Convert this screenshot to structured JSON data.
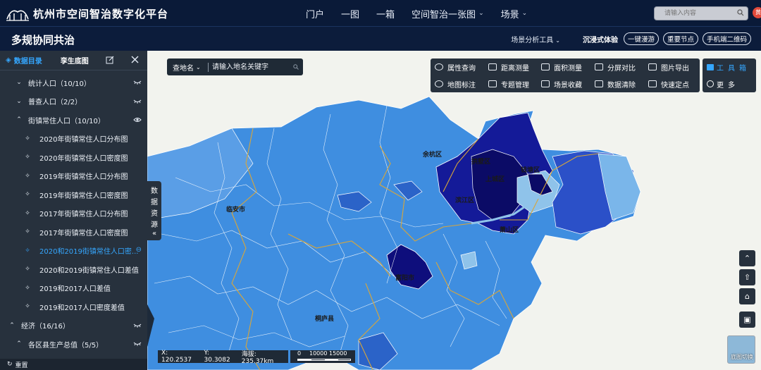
{
  "header": {
    "title": "杭州市空间智治数字化平台",
    "nav": [
      {
        "label": "门户",
        "has_menu": false
      },
      {
        "label": "一图",
        "has_menu": false
      },
      {
        "label": "一箱",
        "has_menu": false
      },
      {
        "label": "空间智治一张图",
        "has_menu": true
      },
      {
        "label": "场景",
        "has_menu": true
      }
    ],
    "search_placeholder": "请输入内容",
    "user_badge": "黄"
  },
  "subheader": {
    "title": "多规协同共治",
    "scene_tools_label": "场景分析工具",
    "immersive_label": "沉浸式体验",
    "buttons": [
      "一键漫游",
      "重要节点",
      "手机端二维码"
    ]
  },
  "left_panel": {
    "tabs": [
      {
        "label": "数据目录",
        "active": true
      },
      {
        "label": "孪生底图",
        "active": false
      }
    ],
    "tree": [
      {
        "label": "统计人口（10/10）",
        "level": 1,
        "expanded": false,
        "eye": "closed"
      },
      {
        "label": "普查人口（2/2）",
        "level": 1,
        "expanded": false,
        "eye": "closed"
      },
      {
        "label": "街镇常住人口（10/10）",
        "level": 1,
        "expanded": true,
        "eye": "open"
      },
      {
        "label": "2020年街镇常住人口分布图",
        "level": 2,
        "eye": "closed"
      },
      {
        "label": "2020年街镇常住人口密度图",
        "level": 2,
        "eye": "closed"
      },
      {
        "label": "2019年街镇常住人口分布图",
        "level": 2,
        "eye": "closed"
      },
      {
        "label": "2019年街镇常住人口密度图",
        "level": 2,
        "eye": "closed"
      },
      {
        "label": "2017年街镇常住人口分布图",
        "level": 2,
        "eye": "closed"
      },
      {
        "label": "2017年街镇常住人口密度图",
        "level": 2,
        "eye": "closed"
      },
      {
        "label": "2020和2019街镇常住人口密...",
        "level": 2,
        "eye": "open",
        "selected": true
      },
      {
        "label": "2020和2019街镇常住人口差值",
        "level": 2,
        "eye": "closed"
      },
      {
        "label": "2019和2017人口差值",
        "level": 2,
        "eye": "closed"
      },
      {
        "label": "2019和2017人口密度差值",
        "level": 2,
        "eye": "closed"
      },
      {
        "label": "经济（16/16）",
        "level": 0,
        "expanded": true,
        "eye": "closed"
      },
      {
        "label": "各区县生产总值（5/5）",
        "level": 1,
        "expanded": true,
        "eye": "closed"
      }
    ],
    "reset_label": "重置",
    "collapse_handle_label": [
      "数",
      "据",
      "资",
      "源"
    ]
  },
  "map": {
    "search_select": "查地名",
    "search_placeholder": "请输入地名关键字",
    "tools": [
      "属性查询",
      "距离测量",
      "面积测量",
      "分屏对比",
      "图片导出",
      "地图标注",
      "专题管理",
      "场景收藏",
      "数据清除",
      "快速定点"
    ],
    "toolbox_label": "工具箱",
    "more_label": "更多",
    "place_labels": [
      "余杭区",
      "拱墅区",
      "钱塘区",
      "上城区",
      "滨江区",
      "萧山区",
      "临安市",
      "富阳市",
      "桐庐县"
    ],
    "coords": {
      "x": "X: 120.2537",
      "y": "Y: 30.3082",
      "elev": "海拔: 235.37km"
    },
    "scale_labels": [
      "0",
      "10000",
      "15000"
    ],
    "basemap_label": "底图切换",
    "colors": {
      "background": "#f2f3ee",
      "light": "#84bde9",
      "mid": "#3f8ee0",
      "mid2": "#2b63c8",
      "dark": "#1c24a8",
      "darkest": "#0c0c78",
      "boundary": "#d8a63a"
    }
  }
}
